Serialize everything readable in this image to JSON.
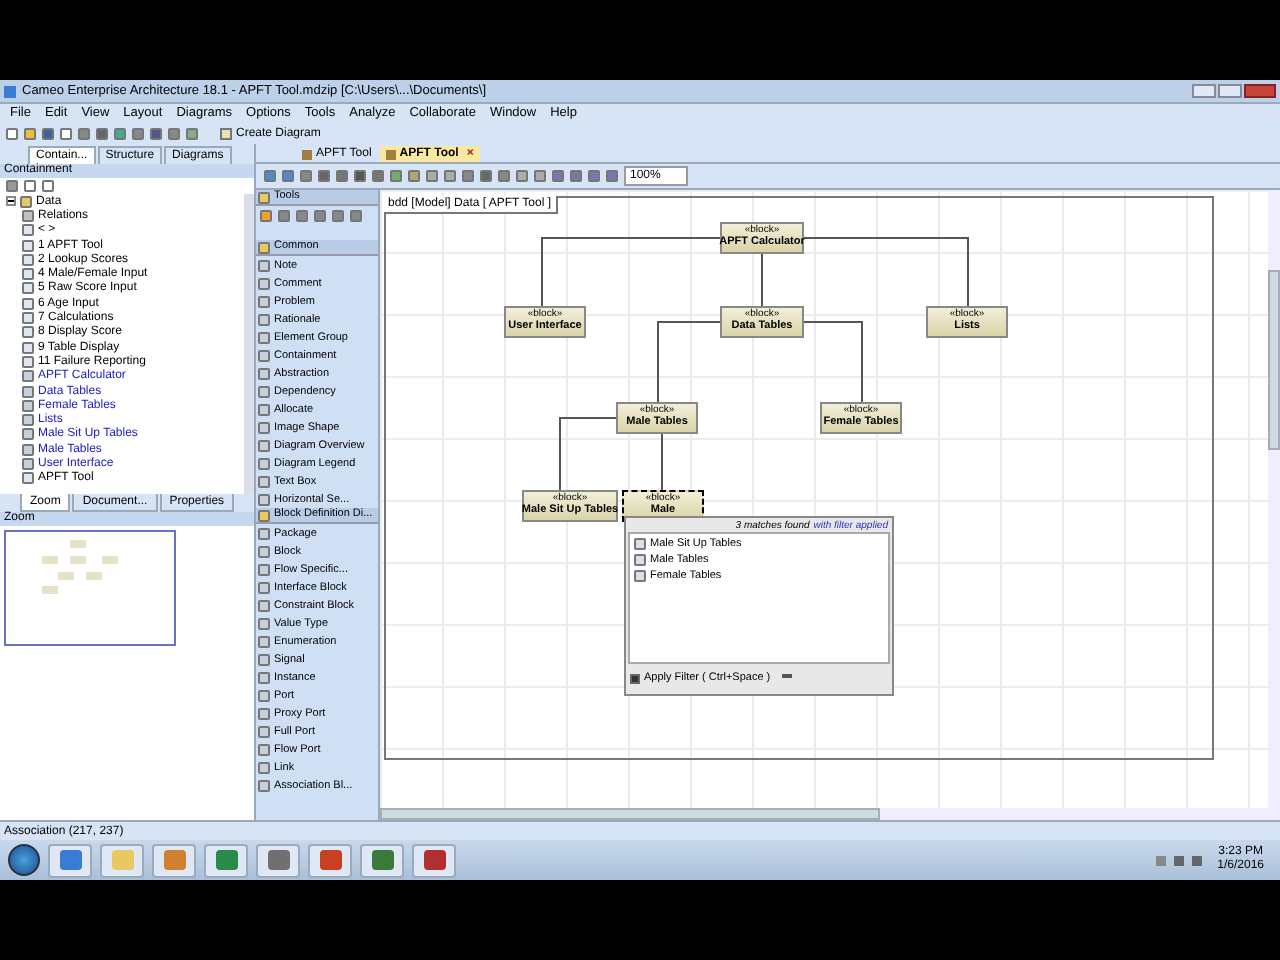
{
  "window": {
    "title": "Cameo Enterprise Architecture 18.1 - APFT Tool.mdzip [C:\\Users\\...\\Documents\\]"
  },
  "menu": [
    "File",
    "Edit",
    "View",
    "Layout",
    "Diagrams",
    "Options",
    "Tools",
    "Analyze",
    "Collaborate",
    "Window",
    "Help"
  ],
  "toolbar": {
    "create_diagram": "Create Diagram"
  },
  "left_tabs": [
    {
      "label": "Contain...",
      "selected": true
    },
    {
      "label": "Structure",
      "selected": false
    },
    {
      "label": "Diagrams",
      "selected": false
    }
  ],
  "containment": {
    "title": "Containment",
    "tree": [
      {
        "label": "Data",
        "kind": "package",
        "expanded": true,
        "children": [
          {
            "label": "Relations",
            "kind": "relations"
          },
          {
            "label": "< >",
            "kind": "diagram"
          },
          {
            "label": "1 APFT Tool",
            "kind": "diagram"
          },
          {
            "label": "2 Lookup Scores",
            "kind": "diagram"
          },
          {
            "label": "4 Male/Female Input",
            "kind": "diagram"
          },
          {
            "label": "5 Raw Score Input",
            "kind": "diagram"
          },
          {
            "label": "6 Age Input",
            "kind": "diagram"
          },
          {
            "label": "7 Calculations",
            "kind": "diagram"
          },
          {
            "label": "8 Display Score",
            "kind": "diagram"
          },
          {
            "label": "9 Table Display",
            "kind": "diagram"
          },
          {
            "label": "11 Failure Reporting",
            "kind": "diagram"
          },
          {
            "label": "APFT Calculator",
            "kind": "block"
          },
          {
            "label": "Data Tables",
            "kind": "block"
          },
          {
            "label": "Female Tables",
            "kind": "block"
          },
          {
            "label": "Lists",
            "kind": "block"
          },
          {
            "label": "Male Sit Up Tables",
            "kind": "block"
          },
          {
            "label": "Male Tables",
            "kind": "block"
          },
          {
            "label": "User Interface",
            "kind": "block"
          },
          {
            "label": "APFT Tool",
            "kind": "diagram"
          }
        ]
      }
    ]
  },
  "bottom_tabs": [
    {
      "label": "Zoom",
      "selected": true
    },
    {
      "label": "Document...",
      "selected": false
    },
    {
      "label": "Properties",
      "selected": false
    }
  ],
  "zoom_panel": {
    "title": "Zoom"
  },
  "editor_tabs": [
    {
      "label": "APFT Tool",
      "selected": false
    },
    {
      "label": "APFT Tool",
      "selected": true,
      "close": "×"
    }
  ],
  "zoom_level": "100%",
  "palette": [
    {
      "title": "Tools",
      "kind": "tools"
    },
    {
      "title": "Common",
      "items": [
        "Note",
        "Comment",
        "Problem",
        "Rationale",
        "Element Group",
        "Containment",
        "Abstraction",
        "Dependency",
        "Allocate",
        "Image Shape",
        "Diagram Overview",
        "Diagram Legend",
        "Text Box",
        "Horizontal Se..."
      ]
    },
    {
      "title": "Block Definition Di...",
      "items": [
        "Package",
        "Block",
        "Flow Specific...",
        "Interface Block",
        "Constraint Block",
        "Value Type",
        "Enumeration",
        "Signal",
        "Instance",
        "Port",
        "Proxy Port",
        "Full Port",
        "Flow Port",
        "Link",
        "Association Bl..."
      ]
    }
  ],
  "diagram": {
    "frame_label": "bdd [Model] Data [ APFT Tool ]",
    "blocks": [
      {
        "stereotype": "«block»",
        "name": "APFT Calculator",
        "selected": false
      },
      {
        "stereotype": "«block»",
        "name": "User Interface",
        "selected": false
      },
      {
        "stereotype": "«block»",
        "name": "Data Tables",
        "selected": false
      },
      {
        "stereotype": "«block»",
        "name": "Lists",
        "selected": false
      },
      {
        "stereotype": "«block»",
        "name": "Male Tables",
        "selected": false
      },
      {
        "stereotype": "«block»",
        "name": "Female Tables",
        "selected": false
      },
      {
        "stereotype": "«block»",
        "name": "Male Sit Up Tables",
        "selected": false
      },
      {
        "stereotype": "«block»",
        "name": "Male",
        "selected": true
      }
    ],
    "popup": {
      "count": "3 matches found",
      "filter_note": "with filter applied",
      "items": [
        "Male Sit Up Tables",
        "Male Tables",
        "Female Tables"
      ],
      "apply_filter": {
        "label": "Apply Filter ( Ctrl+Space )",
        "checked": true
      }
    }
  },
  "status_bar": "Association (217, 237)",
  "clock": {
    "time": "3:23 PM",
    "date": "1/6/2016"
  }
}
